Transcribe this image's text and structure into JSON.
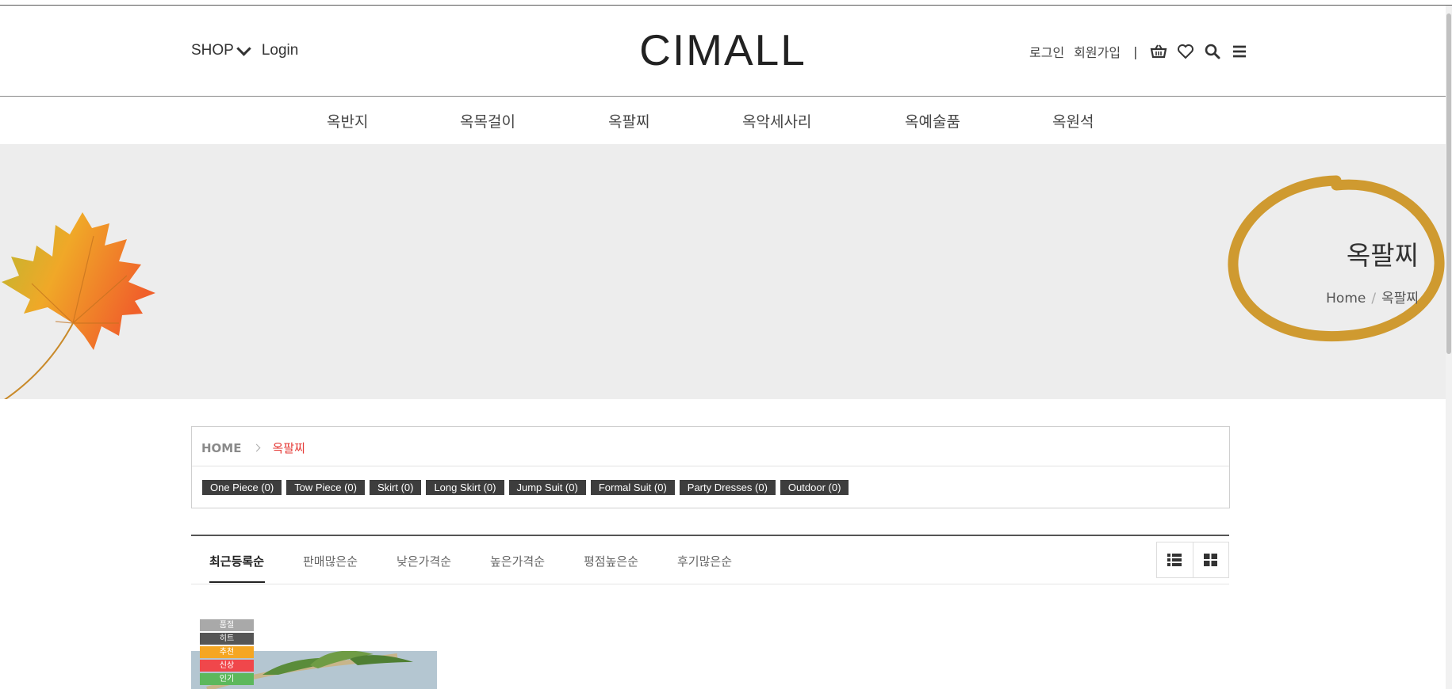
{
  "header": {
    "shop_label": "SHOP",
    "login_label": "Login",
    "logo": "CIMALL",
    "login_kr": "로그인",
    "join_kr": "회원가입",
    "separator": "|"
  },
  "gnb": {
    "items": [
      {
        "label": "옥반지"
      },
      {
        "label": "옥목걸이"
      },
      {
        "label": "옥팔찌"
      },
      {
        "label": "옥악세사리"
      },
      {
        "label": "옥예술품"
      },
      {
        "label": "옥원석"
      }
    ]
  },
  "banner": {
    "title": "옥팔찌",
    "crumb_home": "Home",
    "crumb_sep": "/",
    "crumb_current": "옥팔찌",
    "circle_color": "#cf9a30"
  },
  "category": {
    "home": "HOME",
    "current": "옥팔찌",
    "items": [
      {
        "label": "One Piece (0)"
      },
      {
        "label": "Tow Piece (0)"
      },
      {
        "label": "Skirt (0)"
      },
      {
        "label": "Long Skirt (0)"
      },
      {
        "label": "Jump Suit (0)"
      },
      {
        "label": "Formal Suit (0)"
      },
      {
        "label": "Party Dresses (0)"
      },
      {
        "label": "Outdoor (0)"
      }
    ]
  },
  "sort": {
    "tabs": [
      {
        "label": "최근등록순"
      },
      {
        "label": "판매많은순"
      },
      {
        "label": "낮은가격순"
      },
      {
        "label": "높은가격순"
      },
      {
        "label": "평점높은순"
      },
      {
        "label": "후기많은순"
      }
    ],
    "active_index": 0
  },
  "product": {
    "badges": [
      {
        "label": "품절",
        "color": "#a9a9a9"
      },
      {
        "label": "히트",
        "color": "#555555"
      },
      {
        "label": "추천",
        "color": "#f5a623"
      },
      {
        "label": "신상",
        "color": "#f0474b"
      },
      {
        "label": "인기",
        "color": "#5cb85c"
      }
    ]
  }
}
